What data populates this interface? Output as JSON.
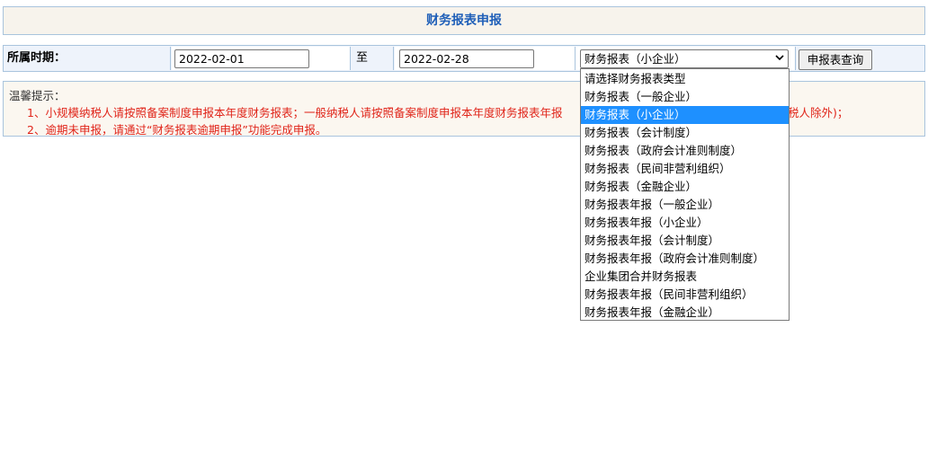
{
  "page": {
    "title": "财务报表申报"
  },
  "filter": {
    "period_label": "所属时期：",
    "start_date": "2022-02-01",
    "to_label": "至",
    "end_date": "2022-02-28",
    "report_type_selected": "财务报表（小企业）",
    "query_button": "申报表查询"
  },
  "notice": {
    "heading": "温馨提示：",
    "line1": "1、小规模纳税人请按照备案制度申报本年度财务报表；一般纳税人请按照备案制度申报本年度财务报表年报",
    "line1_tail": "税人除外)；",
    "line2": "2、逾期未申报，请通过“财务报表逾期申报”功能完成申报。"
  },
  "dropdown": {
    "options": [
      "请选择财务报表类型",
      "财务报表（一般企业）",
      "财务报表（小企业）",
      "财务报表（会计制度）",
      "财务报表（政府会计准则制度）",
      "财务报表（民间非营利组织）",
      "财务报表（金融企业）",
      "财务报表年报（一般企业）",
      "财务报表年报（小企业）",
      "财务报表年报（会计制度）",
      "财务报表年报（政府会计准则制度）",
      "企业集团合并财务报表",
      "财务报表年报（民间非营利组织）",
      "财务报表年报（金融企业）"
    ],
    "selected_index": 2
  },
  "colors": {
    "title_text": "#1f5fb8",
    "notice_text": "#e0251a",
    "border": "#a9c4dd",
    "selected_option_bg": "#1e90ff"
  }
}
